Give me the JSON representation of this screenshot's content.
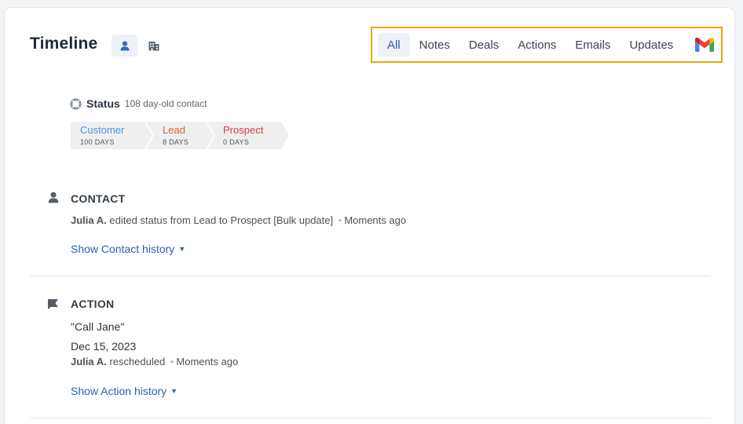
{
  "header": {
    "title": "Timeline",
    "view_icons": [
      "person-icon",
      "building-icon"
    ]
  },
  "filters": {
    "items": [
      "All",
      "Notes",
      "Deals",
      "Actions",
      "Emails",
      "Updates"
    ],
    "active": "All",
    "gmail_icon": "gmail-icon",
    "highlight_color": "#f0a30a"
  },
  "status": {
    "icon": "lifebuoy-icon",
    "label": "Status",
    "subtitle": "108 day-old contact",
    "stages": [
      {
        "name": "Customer",
        "days": "100 DAYS",
        "color": "#4a90e2"
      },
      {
        "name": "Lead",
        "days": "8 DAYS",
        "color": "#e8622a"
      },
      {
        "name": "Prospect",
        "days": "0 DAYS",
        "color": "#d63b4b"
      }
    ]
  },
  "contact_section": {
    "icon": "person-icon",
    "title": "CONTACT",
    "user": "Julia A.",
    "text": "edited status from Lead to Prospect [Bulk update]",
    "dot": "•",
    "time": "Moments ago",
    "link": "Show Contact history"
  },
  "action_section": {
    "icon": "flag-icon",
    "title": "ACTION",
    "quote": "\"Call Jane\"",
    "date": "Dec 15, 2023",
    "user": "Julia A.",
    "text": "rescheduled",
    "dot": "•",
    "time": "Moments ago",
    "link": "Show Action history"
  }
}
